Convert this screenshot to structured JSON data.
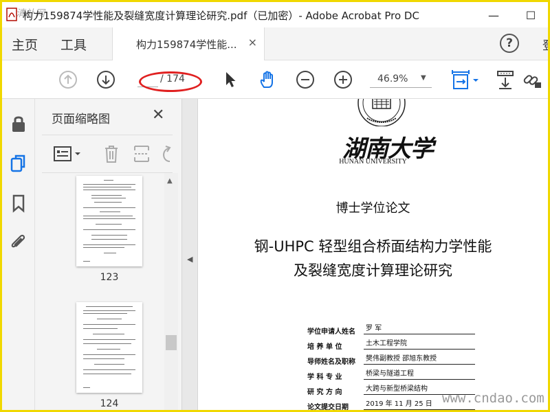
{
  "window": {
    "title": "构力159874学性能及裂缝宽度计算理论研究.pdf（已加密）- Adobe Acrobat Pro DC",
    "minimize_glyph": "—",
    "maximize_glyph": "☐",
    "watermark_left": "清补网"
  },
  "nav": {
    "home": "主页",
    "tools": "工具",
    "doc_tab": "构力159874学性能...",
    "doc_tab_close": "×",
    "help": "?",
    "signin": "登"
  },
  "toolbar": {
    "current_page": "",
    "total_pages": "/ 174",
    "zoom": "46.9%",
    "zoom_arrow": "▼"
  },
  "panel": {
    "title": "页面缩略图",
    "close": "✕",
    "thumbs": [
      {
        "label": "123"
      },
      {
        "label": "124"
      }
    ]
  },
  "document": {
    "university_cn": "湖南大学",
    "university_en": "HUNAN UNIVERSITY",
    "degree": "博士学位论文",
    "title_line1": "钢-UHPC 轻型组合桥面结构力学性能",
    "title_line2": "及裂缝宽度计算理论研究",
    "info": [
      {
        "label": "学位申请人姓名",
        "value": "罗  军"
      },
      {
        "label": "培  养  单  位",
        "value": "土木工程学院"
      },
      {
        "label": "导师姓名及职称",
        "value": "樊伟副教授  邵旭东教授"
      },
      {
        "label": "学  科  专  业",
        "value": "桥梁与隧道工程"
      },
      {
        "label": "研  究  方  向",
        "value": "大跨与新型桥梁结构"
      },
      {
        "label": "论文提交日期",
        "value": "2019 年 11 月 25 日"
      }
    ]
  },
  "watermark_right": "www.cndao.com",
  "colors": {
    "border": "#f0d800",
    "accent": "#1473e6",
    "annotation": "#e02020"
  },
  "icons": [
    "acrobat-icon",
    "arrow-up-icon",
    "arrow-down-icon",
    "pointer-icon",
    "hand-icon",
    "zoom-out-icon",
    "zoom-in-icon",
    "fit-width-icon",
    "scan-icon",
    "link-icon",
    "lock-icon",
    "pages-icon",
    "bookmark-icon",
    "attachment-icon",
    "options-icon",
    "delete-icon",
    "insert-icon",
    "undo-icon"
  ]
}
